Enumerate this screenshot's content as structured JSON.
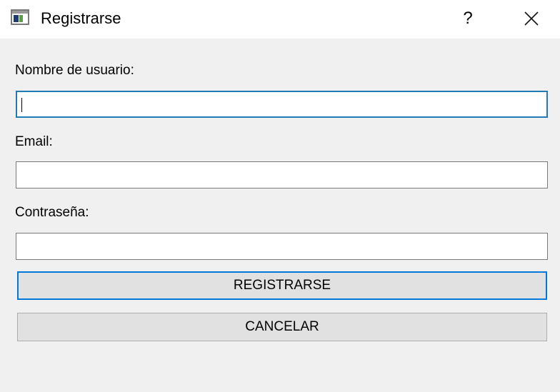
{
  "window": {
    "title": "Registrarse",
    "help_symbol": "?",
    "icons": [
      "app-window-icon",
      "help-icon",
      "close-icon"
    ]
  },
  "form": {
    "username_label": "Nombre de usuario:",
    "username_value": "",
    "email_label": "Email:",
    "email_value": "",
    "password_label": "Contraseña:",
    "password_value": ""
  },
  "buttons": {
    "register_label": "REGISTRARSE",
    "cancel_label": "CANCELAR"
  },
  "colors": {
    "focus_border": "#1f7ab5",
    "default_button_border": "#0078d7",
    "window_background": "#f0f0f0"
  }
}
